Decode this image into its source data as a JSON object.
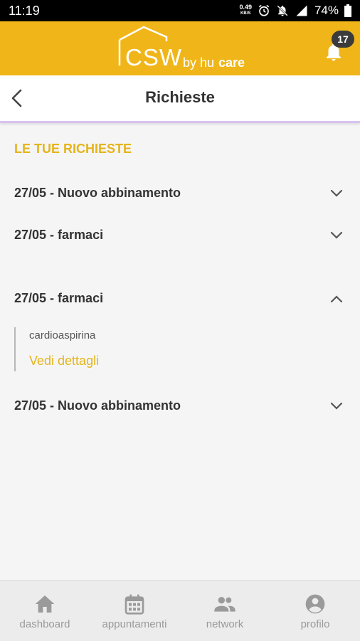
{
  "status": {
    "time": "11:19",
    "netspeed_top": "0.49",
    "netspeed_bottom": "KB/S",
    "battery": "74%"
  },
  "header": {
    "logo_text": "CSW",
    "logo_by": "by hu",
    "logo_brand": "care",
    "notifications_count": "17"
  },
  "titlebar": {
    "title": "Richieste"
  },
  "section": {
    "title": "LE TUE RICHIESTE"
  },
  "requests": [
    {
      "label": "27/05 - Nuovo abbinamento",
      "expanded": false
    },
    {
      "label": "27/05 - farmaci",
      "expanded": false
    },
    {
      "label": "27/05 - farmaci",
      "expanded": true,
      "detail": "cardioaspirina",
      "link": "Vedi dettagli"
    },
    {
      "label": "27/05 - Nuovo abbinamento",
      "expanded": false
    }
  ],
  "nav": [
    {
      "label": "dashboard",
      "icon": "home-icon"
    },
    {
      "label": "appuntamenti",
      "icon": "calendar-icon"
    },
    {
      "label": "network",
      "icon": "people-icon"
    },
    {
      "label": "profilo",
      "icon": "account-circle-icon"
    }
  ],
  "colors": {
    "brand": "#f0b619",
    "accent_text": "#e5b41b",
    "title_text": "#333333",
    "nav_icon": "#9a9a9a"
  }
}
